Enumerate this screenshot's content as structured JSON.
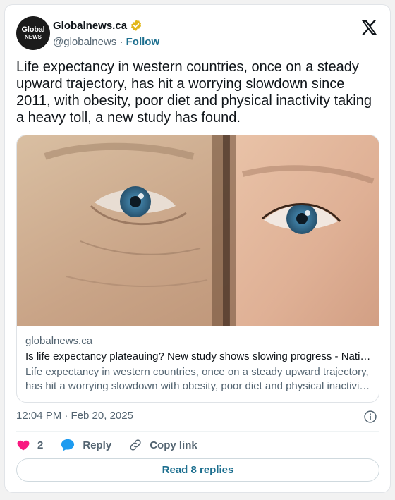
{
  "author": {
    "avatar_line1": "Global",
    "avatar_line2": "NEWS",
    "name": "Globalnews.ca",
    "handle": "@globalnews",
    "separator": "·",
    "follow_label": "Follow",
    "verified_icon": "verified-badge-icon"
  },
  "tweet": {
    "text": "Life expectancy in western countries, once on a steady upward trajectory, has hit a worrying slowdown since 2011, with obesity, poor diet and physical inactivity taking a heavy toll, a new study has found.",
    "timestamp": "12:04 PM · Feb 20, 2025"
  },
  "link_card": {
    "domain": "globalnews.ca",
    "title": "Is life expectancy plateauing? New study shows slowing progress - National | Globalnews.ca",
    "desc_line1": "Life expectancy in western countries, once on a steady upward trajectory,",
    "desc_line2": "has hit a worrying slowdown with obesity, poor diet and physical inactivity taking a heavy toll"
  },
  "actions": {
    "likes": "2",
    "reply_label": "Reply",
    "copy_link_label": "Copy link"
  },
  "read_replies_label": "Read 8 replies",
  "colors": {
    "accent": "#1d6f8f",
    "like": "#f91880",
    "reply": "#1d9bf0",
    "verified": "#e2b719"
  }
}
